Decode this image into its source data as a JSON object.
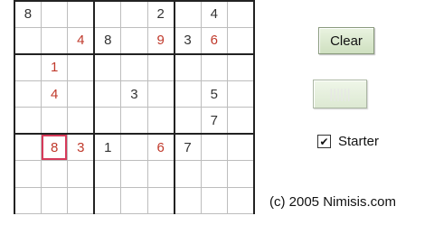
{
  "grid": [
    [
      {
        "v": "8",
        "c": "dark"
      },
      {
        "v": ""
      },
      {
        "v": ""
      },
      {
        "v": ""
      },
      {
        "v": ""
      },
      {
        "v": "2",
        "c": "dark"
      },
      {
        "v": ""
      },
      {
        "v": "4",
        "c": "dark"
      },
      {
        "v": ""
      }
    ],
    [
      {
        "v": ""
      },
      {
        "v": ""
      },
      {
        "v": "4",
        "c": "red"
      },
      {
        "v": "8",
        "c": "dark"
      },
      {
        "v": ""
      },
      {
        "v": "9",
        "c": "red"
      },
      {
        "v": "3",
        "c": "dark"
      },
      {
        "v": "6",
        "c": "red"
      },
      {
        "v": ""
      }
    ],
    [
      {
        "v": ""
      },
      {
        "v": "1",
        "c": "red"
      },
      {
        "v": ""
      },
      {
        "v": ""
      },
      {
        "v": ""
      },
      {
        "v": ""
      },
      {
        "v": ""
      },
      {
        "v": ""
      },
      {
        "v": ""
      }
    ],
    [
      {
        "v": ""
      },
      {
        "v": "4",
        "c": "red"
      },
      {
        "v": ""
      },
      {
        "v": ""
      },
      {
        "v": "3",
        "c": "dark"
      },
      {
        "v": ""
      },
      {
        "v": ""
      },
      {
        "v": "5",
        "c": "dark"
      },
      {
        "v": ""
      }
    ],
    [
      {
        "v": ""
      },
      {
        "v": ""
      },
      {
        "v": ""
      },
      {
        "v": ""
      },
      {
        "v": ""
      },
      {
        "v": ""
      },
      {
        "v": ""
      },
      {
        "v": "7",
        "c": "dark"
      },
      {
        "v": ""
      }
    ],
    [
      {
        "v": ""
      },
      {
        "v": "8",
        "c": "red",
        "sel": true
      },
      {
        "v": "3",
        "c": "red"
      },
      {
        "v": "1",
        "c": "dark"
      },
      {
        "v": ""
      },
      {
        "v": "6",
        "c": "red"
      },
      {
        "v": "7",
        "c": "dark"
      },
      {
        "v": ""
      },
      {
        "v": ""
      }
    ],
    [
      {
        "v": ""
      },
      {
        "v": ""
      },
      {
        "v": ""
      },
      {
        "v": ""
      },
      {
        "v": ""
      },
      {
        "v": ""
      },
      {
        "v": ""
      },
      {
        "v": ""
      },
      {
        "v": ""
      }
    ],
    [
      {
        "v": ""
      },
      {
        "v": ""
      },
      {
        "v": ""
      },
      {
        "v": ""
      },
      {
        "v": ""
      },
      {
        "v": ""
      },
      {
        "v": ""
      },
      {
        "v": ""
      },
      {
        "v": ""
      }
    ]
  ],
  "buttons": {
    "clear_label": "Clear",
    "disabled_label": "||||||"
  },
  "starter": {
    "label": "Starter",
    "checked": true,
    "check_glyph": "✔"
  },
  "copyright": "(c) 2005 Nimisis.com",
  "colors": {
    "given": "#333333",
    "entered": "#c0392b",
    "selection": "#d63a5a"
  }
}
